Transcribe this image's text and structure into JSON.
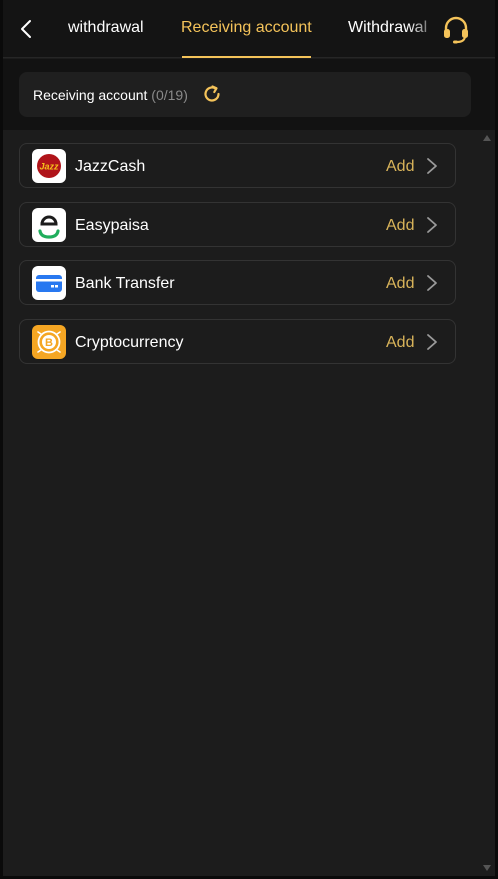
{
  "header": {
    "tabs": [
      {
        "label": "withdrawal",
        "active": false
      },
      {
        "label": "Receiving account",
        "active": true
      },
      {
        "label": "Withdrawal",
        "active": false
      }
    ]
  },
  "summary": {
    "label": "Receiving account",
    "count": "(0/19)"
  },
  "methods": [
    {
      "name": "JazzCash",
      "action": "Add",
      "icon": "jazzcash-logo"
    },
    {
      "name": "Easypaisa",
      "action": "Add",
      "icon": "easypaisa-logo"
    },
    {
      "name": "Bank Transfer",
      "action": "Add",
      "icon": "bank-card-icon"
    },
    {
      "name": "Cryptocurrency",
      "action": "Add",
      "icon": "bitcoin-icon"
    }
  ],
  "colors": {
    "accent": "#f4c35a",
    "add_text": "#d9b45a",
    "background": "#1c1c1c"
  },
  "icons": {
    "back": "chevron-left-icon",
    "support": "headset-icon",
    "refresh": "refresh-icon",
    "chevron": "chevron-right-icon"
  }
}
